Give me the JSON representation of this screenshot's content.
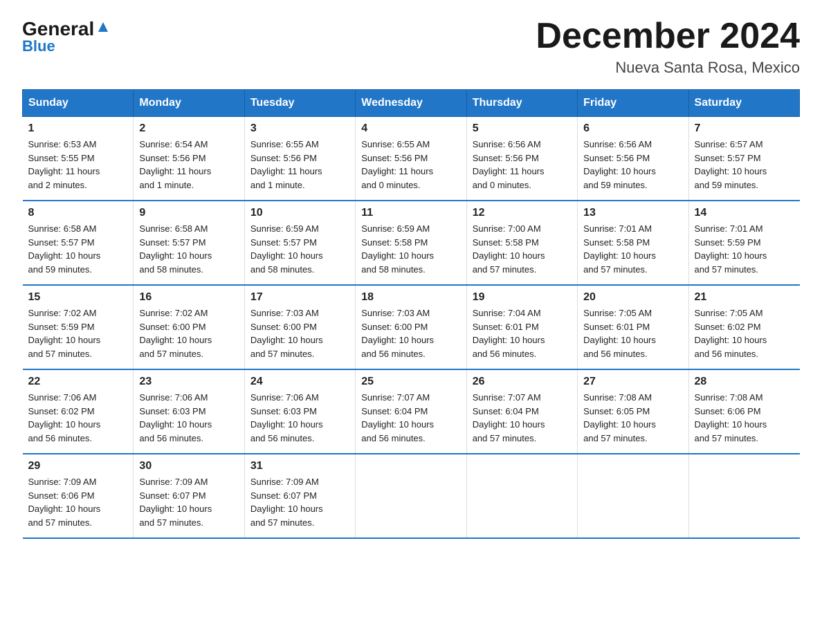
{
  "logo": {
    "name1": "General",
    "name2": "Blue"
  },
  "title": "December 2024",
  "location": "Nueva Santa Rosa, Mexico",
  "days_header": [
    "Sunday",
    "Monday",
    "Tuesday",
    "Wednesday",
    "Thursday",
    "Friday",
    "Saturday"
  ],
  "weeks": [
    [
      {
        "num": "1",
        "info": "Sunrise: 6:53 AM\nSunset: 5:55 PM\nDaylight: 11 hours\nand 2 minutes."
      },
      {
        "num": "2",
        "info": "Sunrise: 6:54 AM\nSunset: 5:56 PM\nDaylight: 11 hours\nand 1 minute."
      },
      {
        "num": "3",
        "info": "Sunrise: 6:55 AM\nSunset: 5:56 PM\nDaylight: 11 hours\nand 1 minute."
      },
      {
        "num": "4",
        "info": "Sunrise: 6:55 AM\nSunset: 5:56 PM\nDaylight: 11 hours\nand 0 minutes."
      },
      {
        "num": "5",
        "info": "Sunrise: 6:56 AM\nSunset: 5:56 PM\nDaylight: 11 hours\nand 0 minutes."
      },
      {
        "num": "6",
        "info": "Sunrise: 6:56 AM\nSunset: 5:56 PM\nDaylight: 10 hours\nand 59 minutes."
      },
      {
        "num": "7",
        "info": "Sunrise: 6:57 AM\nSunset: 5:57 PM\nDaylight: 10 hours\nand 59 minutes."
      }
    ],
    [
      {
        "num": "8",
        "info": "Sunrise: 6:58 AM\nSunset: 5:57 PM\nDaylight: 10 hours\nand 59 minutes."
      },
      {
        "num": "9",
        "info": "Sunrise: 6:58 AM\nSunset: 5:57 PM\nDaylight: 10 hours\nand 58 minutes."
      },
      {
        "num": "10",
        "info": "Sunrise: 6:59 AM\nSunset: 5:57 PM\nDaylight: 10 hours\nand 58 minutes."
      },
      {
        "num": "11",
        "info": "Sunrise: 6:59 AM\nSunset: 5:58 PM\nDaylight: 10 hours\nand 58 minutes."
      },
      {
        "num": "12",
        "info": "Sunrise: 7:00 AM\nSunset: 5:58 PM\nDaylight: 10 hours\nand 57 minutes."
      },
      {
        "num": "13",
        "info": "Sunrise: 7:01 AM\nSunset: 5:58 PM\nDaylight: 10 hours\nand 57 minutes."
      },
      {
        "num": "14",
        "info": "Sunrise: 7:01 AM\nSunset: 5:59 PM\nDaylight: 10 hours\nand 57 minutes."
      }
    ],
    [
      {
        "num": "15",
        "info": "Sunrise: 7:02 AM\nSunset: 5:59 PM\nDaylight: 10 hours\nand 57 minutes."
      },
      {
        "num": "16",
        "info": "Sunrise: 7:02 AM\nSunset: 6:00 PM\nDaylight: 10 hours\nand 57 minutes."
      },
      {
        "num": "17",
        "info": "Sunrise: 7:03 AM\nSunset: 6:00 PM\nDaylight: 10 hours\nand 57 minutes."
      },
      {
        "num": "18",
        "info": "Sunrise: 7:03 AM\nSunset: 6:00 PM\nDaylight: 10 hours\nand 56 minutes."
      },
      {
        "num": "19",
        "info": "Sunrise: 7:04 AM\nSunset: 6:01 PM\nDaylight: 10 hours\nand 56 minutes."
      },
      {
        "num": "20",
        "info": "Sunrise: 7:05 AM\nSunset: 6:01 PM\nDaylight: 10 hours\nand 56 minutes."
      },
      {
        "num": "21",
        "info": "Sunrise: 7:05 AM\nSunset: 6:02 PM\nDaylight: 10 hours\nand 56 minutes."
      }
    ],
    [
      {
        "num": "22",
        "info": "Sunrise: 7:06 AM\nSunset: 6:02 PM\nDaylight: 10 hours\nand 56 minutes."
      },
      {
        "num": "23",
        "info": "Sunrise: 7:06 AM\nSunset: 6:03 PM\nDaylight: 10 hours\nand 56 minutes."
      },
      {
        "num": "24",
        "info": "Sunrise: 7:06 AM\nSunset: 6:03 PM\nDaylight: 10 hours\nand 56 minutes."
      },
      {
        "num": "25",
        "info": "Sunrise: 7:07 AM\nSunset: 6:04 PM\nDaylight: 10 hours\nand 56 minutes."
      },
      {
        "num": "26",
        "info": "Sunrise: 7:07 AM\nSunset: 6:04 PM\nDaylight: 10 hours\nand 57 minutes."
      },
      {
        "num": "27",
        "info": "Sunrise: 7:08 AM\nSunset: 6:05 PM\nDaylight: 10 hours\nand 57 minutes."
      },
      {
        "num": "28",
        "info": "Sunrise: 7:08 AM\nSunset: 6:06 PM\nDaylight: 10 hours\nand 57 minutes."
      }
    ],
    [
      {
        "num": "29",
        "info": "Sunrise: 7:09 AM\nSunset: 6:06 PM\nDaylight: 10 hours\nand 57 minutes."
      },
      {
        "num": "30",
        "info": "Sunrise: 7:09 AM\nSunset: 6:07 PM\nDaylight: 10 hours\nand 57 minutes."
      },
      {
        "num": "31",
        "info": "Sunrise: 7:09 AM\nSunset: 6:07 PM\nDaylight: 10 hours\nand 57 minutes."
      },
      {
        "num": "",
        "info": ""
      },
      {
        "num": "",
        "info": ""
      },
      {
        "num": "",
        "info": ""
      },
      {
        "num": "",
        "info": ""
      }
    ]
  ]
}
